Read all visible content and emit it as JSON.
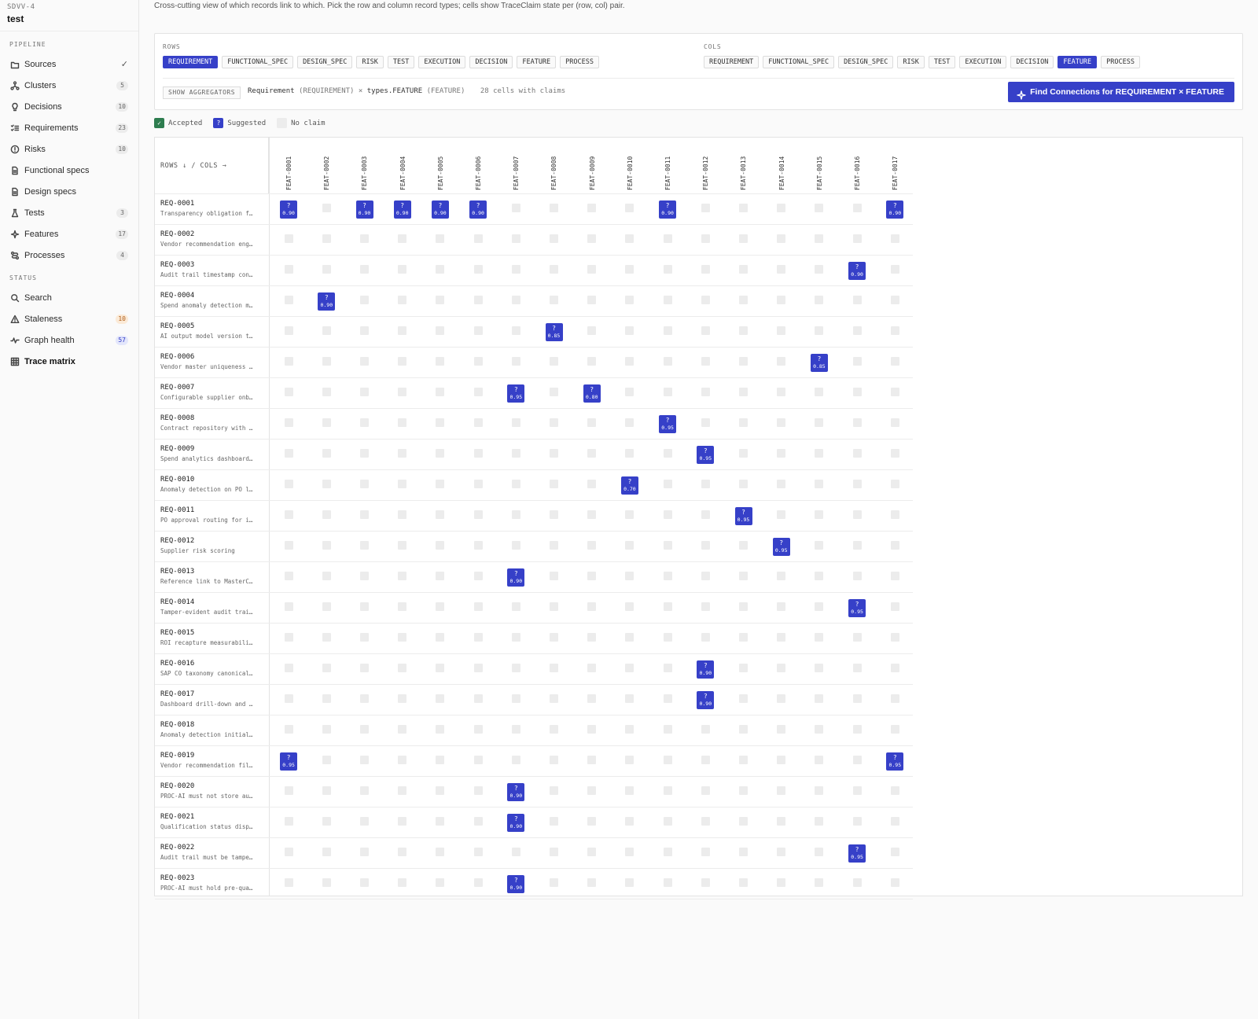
{
  "sidebar": {
    "project_code": "SDVV-4",
    "project_name": "test",
    "sections": [
      {
        "label": "PIPELINE",
        "items": [
          {
            "label": "Sources",
            "icon": "folder-icon",
            "check": "✓"
          },
          {
            "label": "Clusters",
            "icon": "network-icon",
            "count": "5"
          },
          {
            "label": "Decisions",
            "icon": "bulb-icon",
            "count": "10"
          },
          {
            "label": "Requirements",
            "icon": "checklist-icon",
            "count": "23"
          },
          {
            "label": "Risks",
            "icon": "alert-circle-icon",
            "count": "10"
          },
          {
            "label": "Functional specs",
            "icon": "doc-icon"
          },
          {
            "label": "Design specs",
            "icon": "doc-icon"
          },
          {
            "label": "Tests",
            "icon": "flask-icon",
            "count": "3"
          },
          {
            "label": "Features",
            "icon": "sparkle-icon",
            "count": "17"
          },
          {
            "label": "Processes",
            "icon": "route-icon",
            "count": "4"
          }
        ]
      },
      {
        "label": "STATUS",
        "items": [
          {
            "label": "Search",
            "icon": "search-icon"
          },
          {
            "label": "Staleness",
            "icon": "warning-icon",
            "count": "10",
            "count_style": "warn"
          },
          {
            "label": "Graph health",
            "icon": "pulse-icon",
            "count": "57",
            "count_style": "info"
          },
          {
            "label": "Trace matrix",
            "icon": "grid-icon",
            "active": true
          }
        ]
      }
    ]
  },
  "description": "Cross-cutting view of which records link to which. Pick the row and column record types; cells show TraceClaim state per (row, col) pair.",
  "controls": {
    "rows_label": "ROWS",
    "cols_label": "COLS",
    "types": [
      "REQUIREMENT",
      "FUNCTIONAL_SPEC",
      "DESIGN_SPEC",
      "RISK",
      "TEST",
      "EXECUTION",
      "DECISION",
      "FEATURE",
      "PROCESS"
    ],
    "selected_row_type": "REQUIREMENT",
    "selected_col_type": "FEATURE",
    "show_aggregators_label": "SHOW AGGREGATORS",
    "pair_row": "Requirement",
    "pair_row_type": "(REQUIREMENT)",
    "pair_sep": "×",
    "pair_col": "types.FEATURE",
    "pair_col_type": "(FEATURE)",
    "cells_summary": "28 cells with claims",
    "find_button_label": "Find Connections for REQUIREMENT × FEATURE"
  },
  "legend": {
    "accepted": "Accepted",
    "accepted_glyph": "✓",
    "suggested": "Suggested",
    "suggested_glyph": "?",
    "no_claim": "No claim"
  },
  "matrix": {
    "corner_label": "ROWS ↓ / COLS →",
    "suggest_glyph": "?",
    "columns": [
      "FEAT-0001",
      "FEAT-0002",
      "FEAT-0003",
      "FEAT-0004",
      "FEAT-0005",
      "FEAT-0006",
      "FEAT-0007",
      "FEAT-0008",
      "FEAT-0009",
      "FEAT-0010",
      "FEAT-0011",
      "FEAT-0012",
      "FEAT-0013",
      "FEAT-0014",
      "FEAT-0015",
      "FEAT-0016",
      "FEAT-0017"
    ],
    "rows": [
      {
        "id": "REQ-0001",
        "title": "Transparency obligation f…"
      },
      {
        "id": "REQ-0002",
        "title": "Vendor recommendation eng…"
      },
      {
        "id": "REQ-0003",
        "title": "Audit trail timestamp con…"
      },
      {
        "id": "REQ-0004",
        "title": "Spend anomaly detection m…"
      },
      {
        "id": "REQ-0005",
        "title": "AI output model version t…"
      },
      {
        "id": "REQ-0006",
        "title": "Vendor master uniqueness …"
      },
      {
        "id": "REQ-0007",
        "title": "Configurable supplier onb…"
      },
      {
        "id": "REQ-0008",
        "title": "Contract repository with …"
      },
      {
        "id": "REQ-0009",
        "title": "Spend analytics dashboard…"
      },
      {
        "id": "REQ-0010",
        "title": "Anomaly detection on PO l…"
      },
      {
        "id": "REQ-0011",
        "title": "PO approval routing for i…"
      },
      {
        "id": "REQ-0012",
        "title": "Supplier risk scoring"
      },
      {
        "id": "REQ-0013",
        "title": "Reference link to MasterC…"
      },
      {
        "id": "REQ-0014",
        "title": "Tamper-evident audit trai…"
      },
      {
        "id": "REQ-0015",
        "title": "ROI recapture measurabili…"
      },
      {
        "id": "REQ-0016",
        "title": "SAP CO taxonomy canonical…"
      },
      {
        "id": "REQ-0017",
        "title": "Dashboard drill-down and …"
      },
      {
        "id": "REQ-0018",
        "title": "Anomaly detection initial…"
      },
      {
        "id": "REQ-0019",
        "title": "Vendor recommendation fil…"
      },
      {
        "id": "REQ-0020",
        "title": "PROC-AI must not store au…"
      },
      {
        "id": "REQ-0021",
        "title": "Qualification status disp…"
      },
      {
        "id": "REQ-0022",
        "title": "Audit trail must be tampe…"
      },
      {
        "id": "REQ-0023",
        "title": "PROC-AI must hold pre-qua…"
      }
    ],
    "claims": [
      {
        "row": 0,
        "col": 0,
        "confidence": "0.90"
      },
      {
        "row": 0,
        "col": 2,
        "confidence": "0.90"
      },
      {
        "row": 0,
        "col": 3,
        "confidence": "0.90"
      },
      {
        "row": 0,
        "col": 4,
        "confidence": "0.90"
      },
      {
        "row": 0,
        "col": 5,
        "confidence": "0.90"
      },
      {
        "row": 0,
        "col": 10,
        "confidence": "0.90"
      },
      {
        "row": 0,
        "col": 16,
        "confidence": "0.90"
      },
      {
        "row": 2,
        "col": 15,
        "confidence": "0.90"
      },
      {
        "row": 3,
        "col": 1,
        "confidence": "0.90"
      },
      {
        "row": 4,
        "col": 7,
        "confidence": "0.85"
      },
      {
        "row": 5,
        "col": 14,
        "confidence": "0.85"
      },
      {
        "row": 6,
        "col": 6,
        "confidence": "0.95"
      },
      {
        "row": 6,
        "col": 8,
        "confidence": "0.80"
      },
      {
        "row": 7,
        "col": 10,
        "confidence": "0.95"
      },
      {
        "row": 8,
        "col": 11,
        "confidence": "0.95"
      },
      {
        "row": 9,
        "col": 9,
        "confidence": "0.70"
      },
      {
        "row": 10,
        "col": 12,
        "confidence": "0.95"
      },
      {
        "row": 11,
        "col": 13,
        "confidence": "0.95"
      },
      {
        "row": 12,
        "col": 6,
        "confidence": "0.90"
      },
      {
        "row": 13,
        "col": 15,
        "confidence": "0.95"
      },
      {
        "row": 15,
        "col": 11,
        "confidence": "0.90"
      },
      {
        "row": 16,
        "col": 11,
        "confidence": "0.90"
      },
      {
        "row": 18,
        "col": 0,
        "confidence": "0.95"
      },
      {
        "row": 18,
        "col": 16,
        "confidence": "0.95"
      },
      {
        "row": 19,
        "col": 6,
        "confidence": "0.90"
      },
      {
        "row": 20,
        "col": 6,
        "confidence": "0.90"
      },
      {
        "row": 21,
        "col": 15,
        "confidence": "0.95"
      },
      {
        "row": 22,
        "col": 6,
        "confidence": "0.90"
      }
    ]
  }
}
